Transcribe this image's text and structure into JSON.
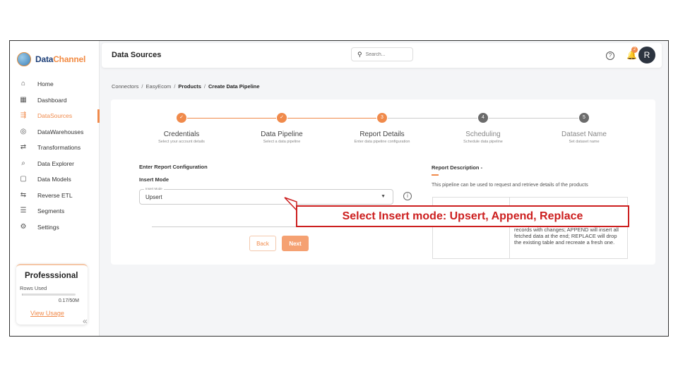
{
  "brand": {
    "name_part1": "Data",
    "name_part2": "Channel"
  },
  "sidebar": {
    "items": [
      {
        "label": "Home",
        "icon": "home-icon",
        "glyph": "⌂"
      },
      {
        "label": "Dashboard",
        "icon": "dashboard-icon",
        "glyph": "▦"
      },
      {
        "label": "DataSources",
        "icon": "datasources-icon",
        "glyph": "⇶",
        "active": true
      },
      {
        "label": "DataWarehouses",
        "icon": "database-icon",
        "glyph": "◎"
      },
      {
        "label": "Transformations",
        "icon": "transformations-icon",
        "glyph": "⇄"
      },
      {
        "label": "Data Explorer",
        "icon": "explorer-icon",
        "glyph": "⌕"
      },
      {
        "label": "Data Models",
        "icon": "models-icon",
        "glyph": "▢"
      },
      {
        "label": "Reverse ETL",
        "icon": "reverse-etl-icon",
        "glyph": "⇆"
      },
      {
        "label": "Segments",
        "icon": "segments-icon",
        "glyph": "☰"
      },
      {
        "label": "Settings",
        "icon": "settings-icon",
        "glyph": "⚙"
      }
    ],
    "plan": {
      "title": "Professsional",
      "rows_label": "Rows Used",
      "usage_fraction": 0.0034,
      "count": "0.17/50M",
      "link": "View Usage"
    },
    "collapse_glyph": "«"
  },
  "header": {
    "title": "Data Sources",
    "search_placeholder": "Search...",
    "help_glyph": "?",
    "notification_count": "2",
    "avatar_initial": "R"
  },
  "breadcrumb": {
    "items": [
      "Connectors",
      "EasyEcom",
      "Products",
      "Create Data Pipeline"
    ],
    "separator": "/"
  },
  "stepper": {
    "steps": [
      {
        "title": "Credentials",
        "subtitle": "Select your account details",
        "state": "done",
        "marker": "✓"
      },
      {
        "title": "Data Pipeline",
        "subtitle": "Select a data pipeline",
        "state": "done",
        "marker": "✓"
      },
      {
        "title": "Report Details",
        "subtitle": "Enter data pipeline configuration",
        "state": "current",
        "marker": "3"
      },
      {
        "title": "Scheduling",
        "subtitle": "Schedule data pipeline",
        "state": "pending",
        "marker": "4"
      },
      {
        "title": "Dataset Name",
        "subtitle": "Set dataset name",
        "state": "pending",
        "marker": "5"
      }
    ]
  },
  "form": {
    "section_title": "Enter Report Configuration",
    "field_label": "Insert Mode",
    "select_float_label": "Insert Mode",
    "select_value": "Upsert",
    "caret": "▼",
    "info_glyph": "i",
    "back_label": "Back",
    "next_label": "Next"
  },
  "description": {
    "title": "Report Description -",
    "text": "This pipeline can be used to request and retrieve details of the products",
    "table_text": "records with changes; APPEND will insert all fetched data at the end; REPLACE will drop the existing table and recreate a fresh one."
  },
  "annotation": {
    "text": "Select Insert mode: Upsert, Append, Replace"
  },
  "colors": {
    "accent": "#f08a4b",
    "callout": "#cc1f1f",
    "pending": "#6b6b6b"
  }
}
